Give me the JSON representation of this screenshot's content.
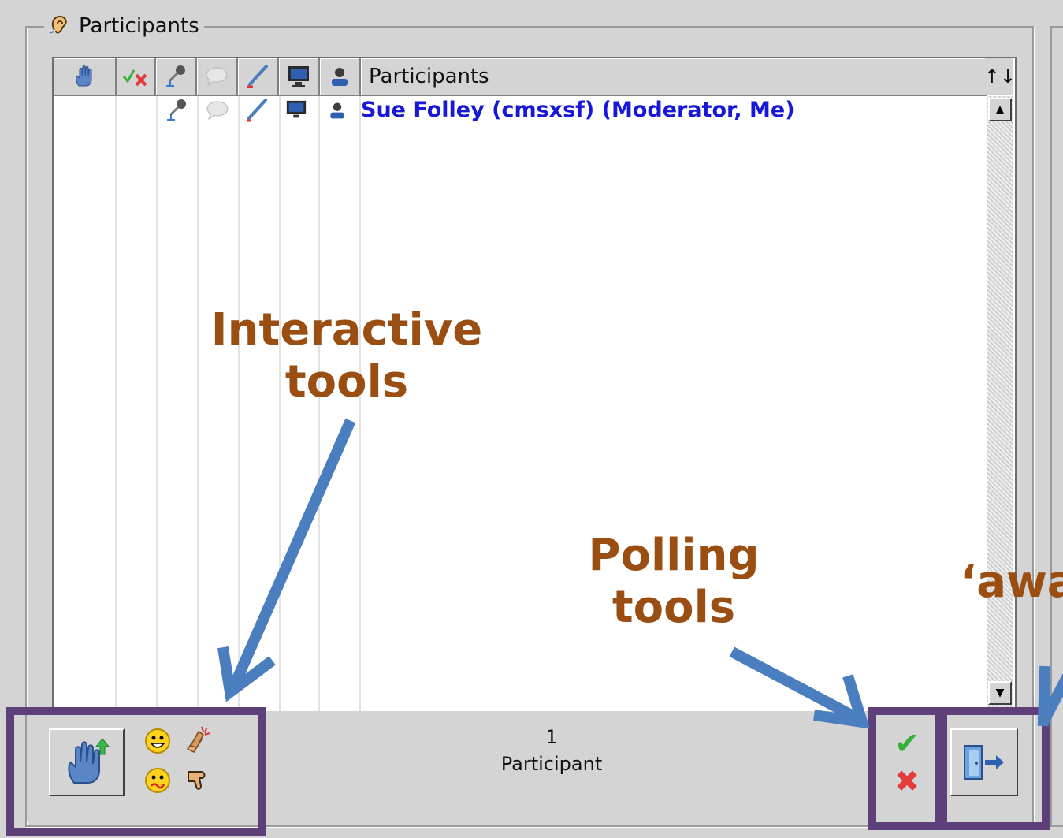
{
  "panel": {
    "title": "Participants",
    "title_icon": "ear-icon"
  },
  "list": {
    "columns": [
      {
        "icon": "raise-hand-icon"
      },
      {
        "icon": "poll-yes-no-icon"
      },
      {
        "icon": "microphone-icon"
      },
      {
        "icon": "chat-bubble-icon"
      },
      {
        "icon": "pencil-icon"
      },
      {
        "icon": "monitor-icon"
      },
      {
        "icon": "user-icon"
      },
      {
        "label": "Participants"
      }
    ],
    "sort_glyph": "↑↓",
    "rows": [
      {
        "name": "Sue Folley (cmsxsf) (Moderator, Me)",
        "color": "#1717d9"
      }
    ]
  },
  "footer": {
    "count_number": "1",
    "count_label": "Participant",
    "raise_hand_icon": "raise-hand-button-icon",
    "emotions": [
      "smile-icon",
      "applause-icon",
      "confused-icon",
      "thumbs-down-icon"
    ],
    "poll_yes_glyph": "✔",
    "poll_no_glyph": "✖",
    "away_icon": "exit-door-icon"
  },
  "annotations": {
    "interactive": [
      "Interactive",
      "tools"
    ],
    "polling": [
      "Polling",
      "tools"
    ],
    "away": "‘awa"
  },
  "colors": {
    "annotation_text": "#9a4e12",
    "arrow": "#4a7ebf",
    "highlight": "#5e3f7a",
    "name_text": "#1717d9"
  }
}
